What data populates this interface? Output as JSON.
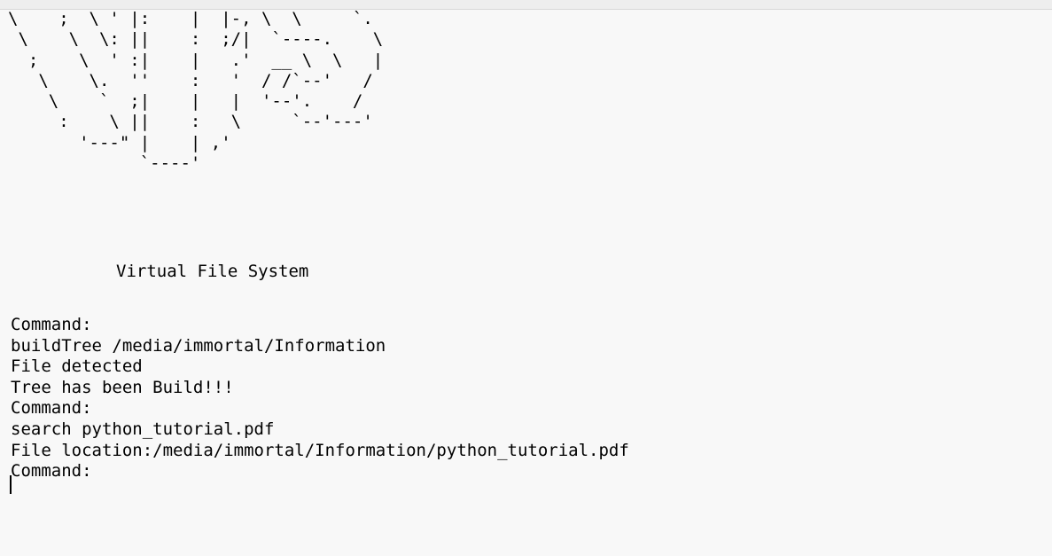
{
  "ascii_art": "\\    ;  \\ ' |:    |  |-, \\  \\     `.\n \\    \\  \\: ||    :  ;/|  `----.    \\\n  ;    \\  ' :|    |   .'  __ \\  \\   |\n   \\    \\.  ''    :   '  / /`--'   /\n    \\    `  ;|    |   |  '--'.    /\n     :    \\ ||    :   \\     `--'---'\n       '---\" |    | ,'\n             `----'",
  "title": "Virtual File System",
  "lines": [
    "Command:",
    "buildTree /media/immortal/Information",
    "File detected",
    "Tree has been Build!!!",
    "Command:",
    "search python_tutorial.pdf",
    "File location:/media/immortal/Information/python_tutorial.pdf",
    "Command:"
  ]
}
